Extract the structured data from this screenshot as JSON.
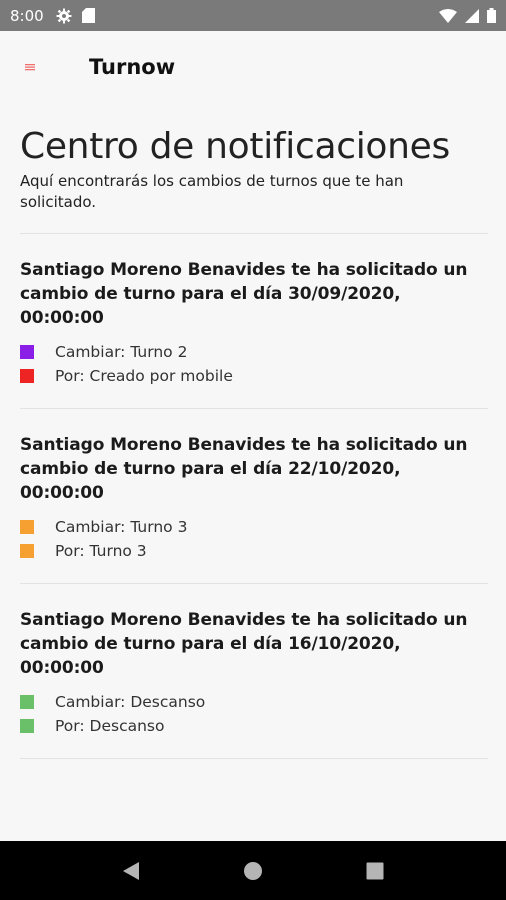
{
  "status_bar": {
    "time": "8:00",
    "left_icons": [
      "gear-icon",
      "sd-card-icon"
    ],
    "right_icons": [
      "wifi-icon",
      "signal-icon",
      "battery-icon"
    ]
  },
  "app_bar": {
    "menu_icon": "menu-icon",
    "title": "Turnow"
  },
  "page": {
    "title": "Centro de notificaciones",
    "subtitle": "Aquí encontrarás los cambios de turnos que te han solicitado."
  },
  "notifications": [
    {
      "text": "Santiago Moreno Benavides te ha solicitado un cambio de turno para el día 30/09/2020, 00:00:00",
      "changes": [
        {
          "label": "Cambiar: Turno 2",
          "color": "#8a1ee6"
        },
        {
          "label": "Por: Creado por mobile",
          "color": "#ee2424"
        }
      ]
    },
    {
      "text": "Santiago Moreno Benavides te ha solicitado un cambio de turno para el día 22/10/2020, 00:00:00",
      "changes": [
        {
          "label": "Cambiar: Turno 3",
          "color": "#f5a030"
        },
        {
          "label": "Por: Turno 3",
          "color": "#f5a030"
        }
      ]
    },
    {
      "text": "Santiago Moreno Benavides te ha solicitado un cambio de turno para el día 16/10/2020, 00:00:00",
      "changes": [
        {
          "label": "Cambiar: Descanso",
          "color": "#6abf69"
        },
        {
          "label": "Por: Descanso",
          "color": "#6abf69"
        }
      ]
    }
  ],
  "nav_bar": {
    "buttons": [
      "back-icon",
      "home-icon",
      "recents-icon"
    ]
  },
  "colors": {
    "status_bar_bg": "#7a7a7a",
    "background": "#f7f7f7",
    "menu_accent": "#f07070",
    "nav_bar_bg": "#000000"
  }
}
